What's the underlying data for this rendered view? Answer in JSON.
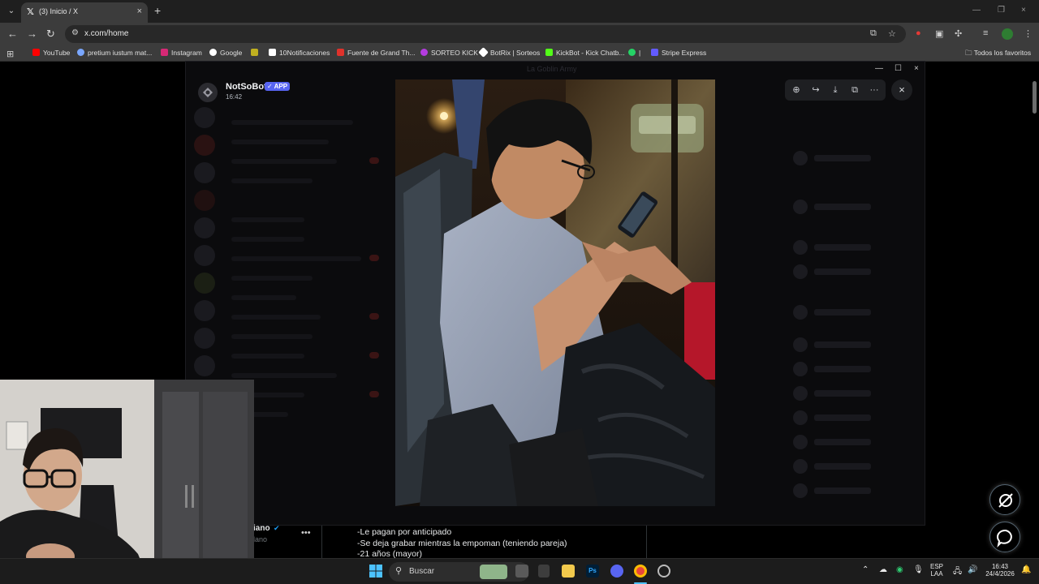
{
  "browser": {
    "tab_title": "(3) Inicio / X",
    "url": "x.com/home",
    "bookmarks": [
      {
        "label": "YouTube",
        "color": "#ff0000"
      },
      {
        "label": "pretium iustum mat...",
        "color": "#7aa7ff"
      },
      {
        "label": "Instagram",
        "color": "#d62976"
      },
      {
        "label": "Google",
        "color": "#4285f4"
      },
      {
        "label": "",
        "color": "#c0b020"
      },
      {
        "label": "10Notificaciones",
        "color": "#ffffff"
      },
      {
        "label": "Fuente de Grand Th...",
        "color": "#e0322b"
      },
      {
        "label": "SORTEO KICK",
        "color": "#b43ce0"
      },
      {
        "label": "BotRix | Sorteos",
        "color": "#ffffff"
      },
      {
        "label": "KickBot - Kick Chatb...",
        "color": "#53fc18"
      },
      {
        "label": "|",
        "color": "#25d366"
      },
      {
        "label": "Stripe Express",
        "color": "#635bff"
      }
    ],
    "all_bookmarks": "Todos los favoritos"
  },
  "viewer": {
    "author": "NotSoBot",
    "badge": "✓ APP",
    "time": "16:42",
    "discord_title": "La Goblin Army"
  },
  "tweet": {
    "line1": "-Le pagan por anticipado",
    "line2": "-Se deja grabar mientras la empoman (teniendo pareja)",
    "line3": "-21 años (mayor)",
    "author_partial": "iano",
    "handle_partial": "lano"
  },
  "taskbar": {
    "search_label": "Buscar",
    "lang_top": "ESP",
    "lang_bottom": "LAA",
    "time": "16:43",
    "date": "24/4/2026"
  },
  "icons": {
    "close": "×",
    "back": "←",
    "forward": "→",
    "reload": "↻",
    "star": "☆",
    "more": "⋮"
  }
}
